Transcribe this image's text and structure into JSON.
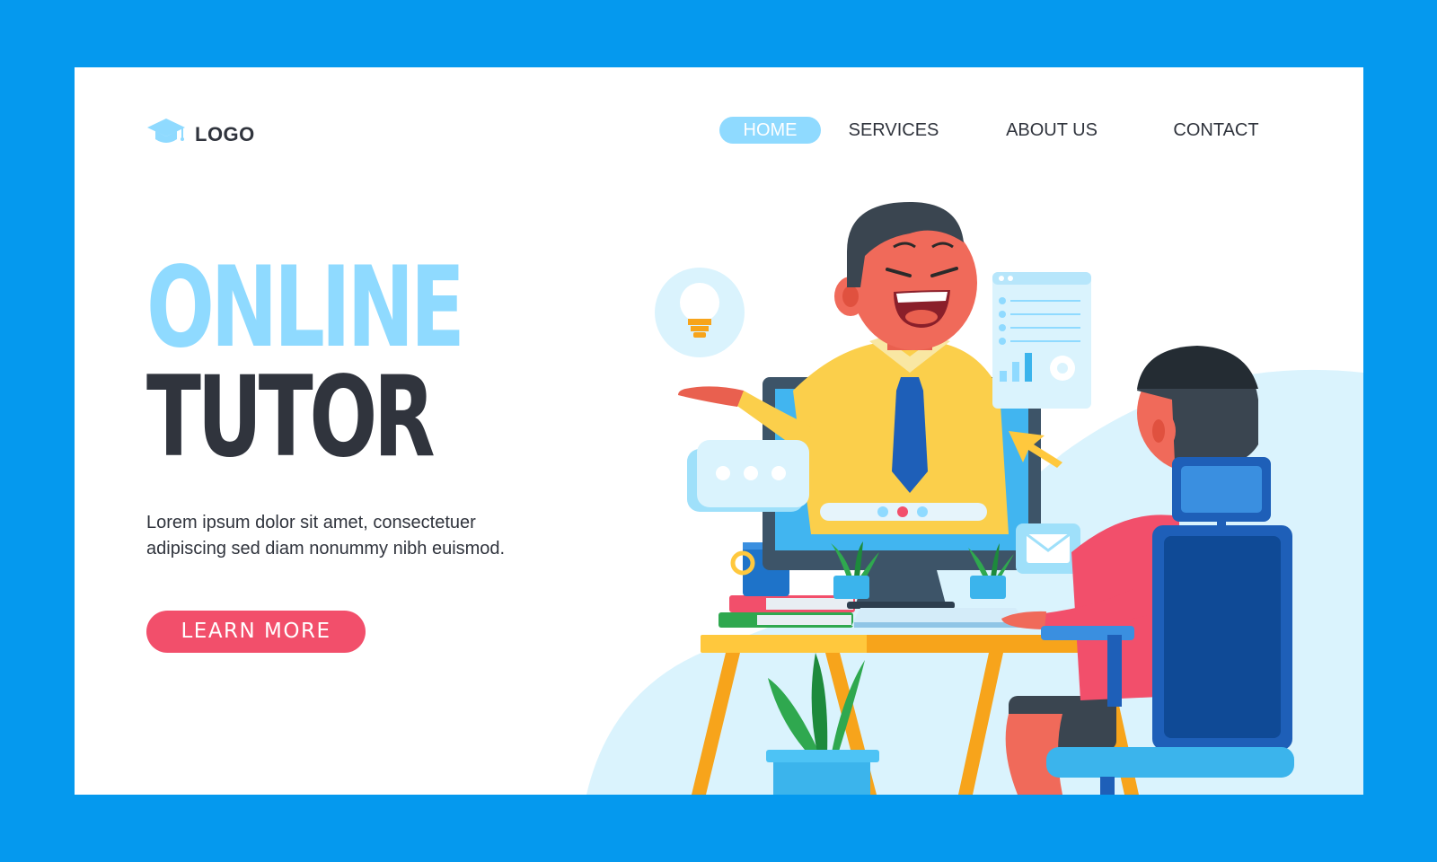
{
  "logo": {
    "icon": "graduation-cap-icon",
    "text": "LOGO"
  },
  "nav": {
    "items": [
      {
        "label": "HOME",
        "active": true
      },
      {
        "label": "SERVICES",
        "active": false
      },
      {
        "label": "ABOUT US",
        "active": false
      },
      {
        "label": "CONTACT",
        "active": false
      }
    ]
  },
  "hero": {
    "title_line1": "ONLINE",
    "title_line2": "TUTOR",
    "description_line1": "Lorem ipsum dolor sit amet, consectetuer",
    "description_line2": "adipiscing sed diam nonummy nibh euismod.",
    "cta_label": "LEARN MORE"
  },
  "colors": {
    "frame": "#0599ee",
    "accent_light": "#8fdaff",
    "dark_text": "#30343d",
    "cta": "#f24f6b"
  }
}
